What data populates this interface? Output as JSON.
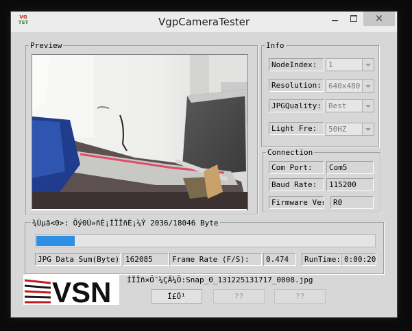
{
  "window": {
    "title": "VgpCameraTester",
    "icon_text": [
      "VG",
      "TST"
    ],
    "close_glyph": "✕"
  },
  "preview": {
    "legend": "Preview"
  },
  "info": {
    "legend": "Info",
    "node_index": {
      "label": "NodeIndex:",
      "value": "1"
    },
    "resolution": {
      "label": "Resolution:",
      "value": "640x480"
    },
    "jpg_quality": {
      "label": "JPGQuality:",
      "value": "Best"
    },
    "light_freq": {
      "label": "Light Fre:",
      "value": "50HZ"
    }
  },
  "connection": {
    "legend": "Connection",
    "com_port": {
      "label": "Com Port:",
      "value": "Com5"
    },
    "baud_rate": {
      "label": "Baud Rate:",
      "value": "115200"
    },
    "firmware": {
      "label": "Firmware Ver",
      "value": "R0"
    }
  },
  "status": {
    "text": "¾Ùµã<0>: Õý0Ú»ñÈ¡ÍÏÎñÈ¡¼Ý 2036/18046 Byte",
    "progress_fraction": 0.1128
  },
  "stats": {
    "jpg_sum_label": "JPG Data Sum(Byte):",
    "jpg_sum_value": "162085",
    "frame_rate_label": "Frame Rate (F/S):",
    "frame_rate_value": "0.474",
    "runtime_label": "RunTime:",
    "runtime_value": "0:00:20"
  },
  "logo": {
    "text": "VSN"
  },
  "footer": {
    "path_text": "ÍÏÎñ×Ö¯¼ÇÂ¼Õ:Snap_0_131225131717_0008.jpg",
    "button1": "Í£Ö¹",
    "button2": "??",
    "button3": "??"
  }
}
